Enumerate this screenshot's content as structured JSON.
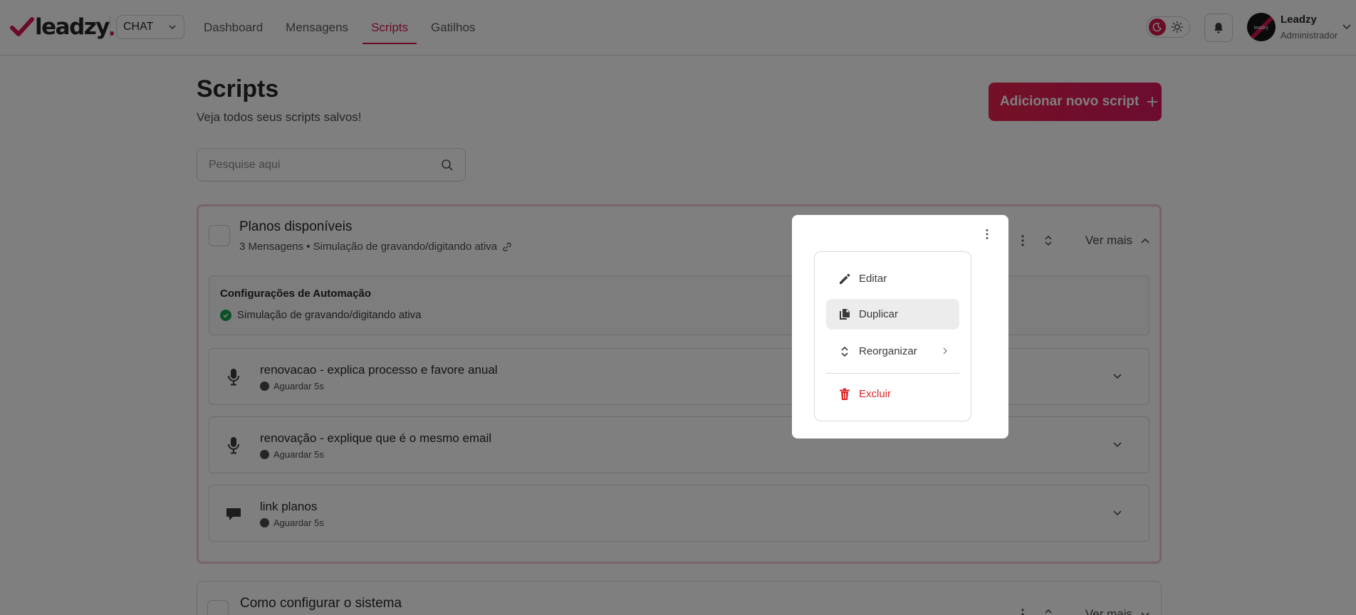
{
  "brand": {
    "logo_text": "leadzy",
    "accent": "#d6164d"
  },
  "header": {
    "channel_select": "CHAT",
    "nav": [
      {
        "label": "Dashboard",
        "active": false
      },
      {
        "label": "Mensagens",
        "active": false
      },
      {
        "label": "Scripts",
        "active": true
      },
      {
        "label": "Gatilhos",
        "active": false
      }
    ],
    "user": {
      "name": "Leadzy",
      "role": "Administrador",
      "avatar_text": "leadzy"
    }
  },
  "page": {
    "title": "Scripts",
    "subtitle": "Veja todos seus scripts salvos!",
    "add_button": "Adicionar novo script",
    "search_placeholder": "Pesquise aqui"
  },
  "scripts": [
    {
      "title": "Planos disponíveis",
      "meta": "3 Mensagens • Simulação de gravando/digitando ativa",
      "ver_mais": "Ver mais",
      "automation": {
        "title": "Configurações de Automação",
        "item": "Simulação de gravando/digitando ativa"
      },
      "messages": [
        {
          "icon": "microphone-icon",
          "title": "renovacao - explica processo e favore anual",
          "wait": "Aguardar 5s"
        },
        {
          "icon": "microphone-icon",
          "title": "renovação - explique que é o mesmo email",
          "wait": "Aguardar 5s"
        },
        {
          "icon": "chat-bubble-icon",
          "title": "link planos",
          "wait": "Aguardar 5s"
        }
      ]
    },
    {
      "title": "Como configurar o sistema",
      "ver_mais": "Ver mais"
    }
  ],
  "context_menu": {
    "items": [
      {
        "label": "Editar",
        "icon": "pencil-icon"
      },
      {
        "label": "Duplicar",
        "icon": "copy-icon",
        "highlighted": true
      },
      {
        "label": "Reorganizar",
        "icon": "reorder-icon"
      },
      {
        "label": "Excluir",
        "icon": "trash-icon",
        "danger": true
      }
    ]
  }
}
